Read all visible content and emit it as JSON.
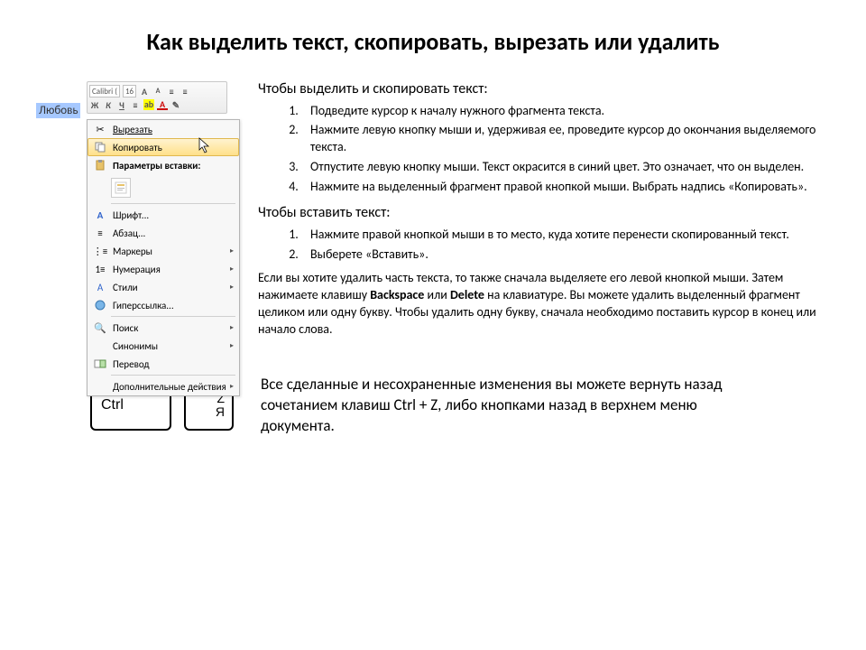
{
  "title": "Как выделить текст, скопировать, вырезать или удалить",
  "word_mock": {
    "selected_text": "Любовь",
    "toolbar": {
      "font_name": "Calibri (",
      "font_size": "16",
      "grow": "A",
      "shrink": "A",
      "bold": "Ж",
      "italic": "К",
      "underline": "Ч",
      "highlight": "ab",
      "font_color": "A"
    },
    "menu": {
      "cut": "Вырезать",
      "copy": "Копировать",
      "paste_options": "Параметры вставки:",
      "font": "Шрифт...",
      "paragraph": "Абзац...",
      "bullets": "Маркеры",
      "numbering": "Нумерация",
      "styles": "Стили",
      "hyperlink": "Гиперссылка...",
      "search": "Поиск",
      "synonyms": "Синонимы",
      "translate": "Перевод",
      "more_actions": "Дополнительные действия"
    }
  },
  "section1": {
    "heading": "Чтобы выделить и скопировать текст:",
    "items": [
      "Подведите курсор к началу нужного фрагмента текста.",
      "Нажмите левую кнопку мыши и, удерживая ее, проведите курсор до окончания выделяемого текста.",
      "Отпустите левую кнопку мыши. Текст окрасится в синий цвет. Это означает, что он выделен.",
      "Нажмите на выделенный фрагмент правой кнопкой мыши. Выбрать надпись «Копировать»."
    ]
  },
  "section2": {
    "heading": "Чтобы вставить текст:",
    "items": [
      "Нажмите правой кнопкой мыши в то место, куда хотите перенести скопированный текст.",
      "Выберете «Вставить»."
    ]
  },
  "delete_para_pre": "Если вы хотите удалить часть текста, то также сначала выделяете его левой кнопкой мыши. Затем нажимаете клавишу ",
  "backspace": "Backspace",
  "or": " или ",
  "delete": "Delete",
  "delete_para_post": " на клавиатуре. Вы можете удалить выделенный фрагмент целиком или одну букву. Чтобы удалить одну букву, сначала необходимо поставить курсор в конец или начало слова.",
  "keys": {
    "ctrl": "Ctrl",
    "z_top": "Z",
    "z_bot": "Я"
  },
  "tip": "Все сделанные и несохраненные изменения вы можете вернуть назад сочетанием клавиш Ctrl + Z, либо кнопками назад в верхнем меню документа."
}
